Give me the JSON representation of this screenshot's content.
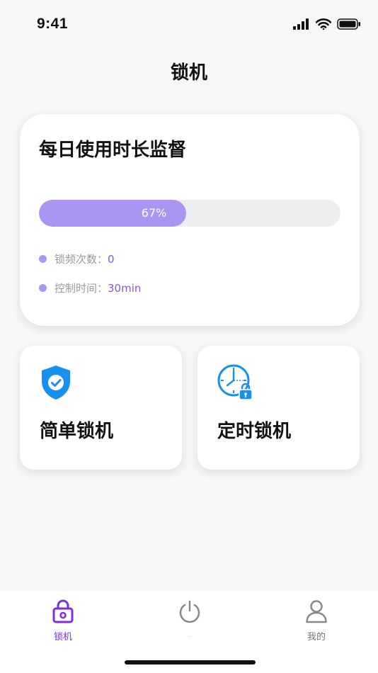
{
  "status_bar": {
    "time": "9:41"
  },
  "header": {
    "title": "锁机"
  },
  "stats_card": {
    "title": "每日使用时长监督",
    "progress": {
      "percent": 67,
      "label": "67%"
    },
    "rows": [
      {
        "label": "锁频次数：",
        "value": "0"
      },
      {
        "label": "控制时间：",
        "value": "30min"
      }
    ]
  },
  "actions": [
    {
      "label": "简单锁机",
      "icon": "shield-check-icon"
    },
    {
      "label": "定时锁机",
      "icon": "clock-lock-icon"
    }
  ],
  "tabs": [
    {
      "label": "锁机",
      "icon": "lock-icon",
      "active": true
    },
    {
      "label": "...",
      "icon": "power-icon",
      "active": false
    },
    {
      "label": "我的",
      "icon": "user-icon",
      "active": false
    }
  ],
  "colors": {
    "accent": "#7b2fe0",
    "progress": "#ab95f2",
    "icon_blue": "#1890f0"
  }
}
